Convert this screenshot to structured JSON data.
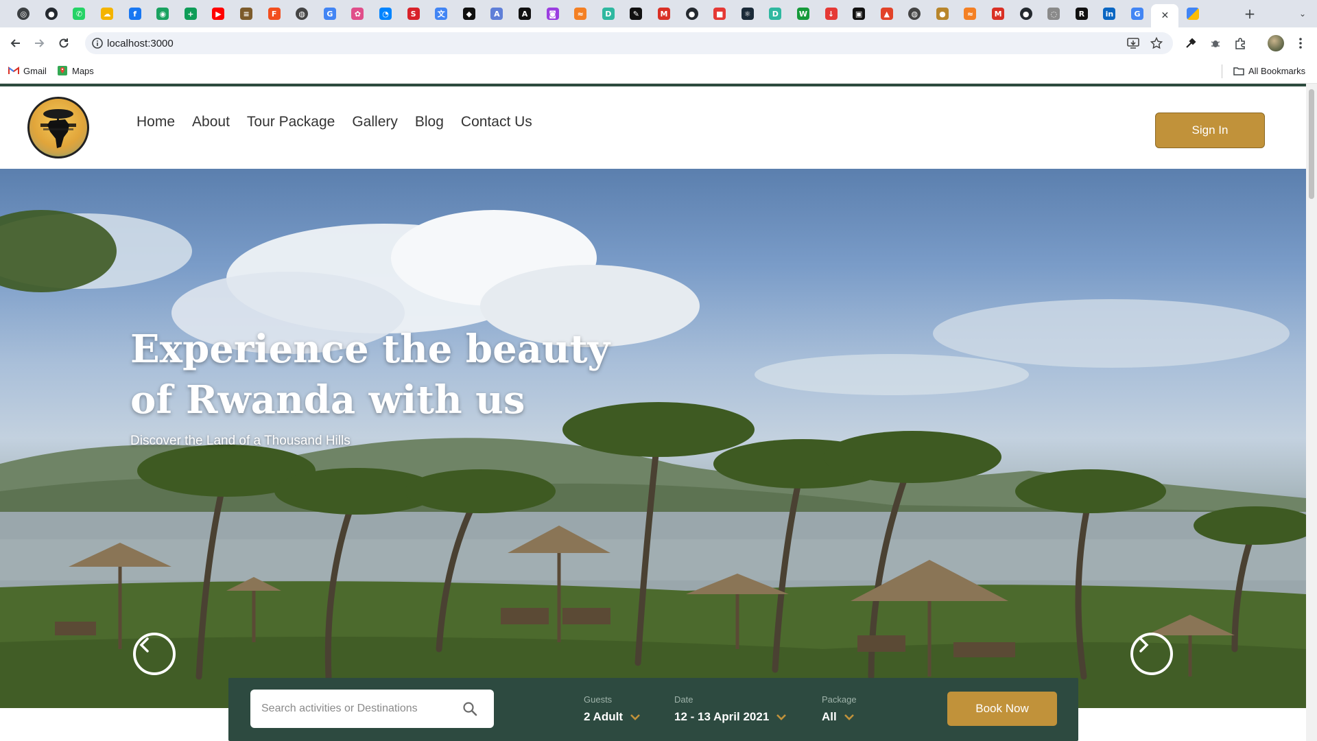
{
  "browser": {
    "tabs": [
      {
        "icon": "chrome-icon",
        "color": "#3c4043",
        "glyph": "◎"
      },
      {
        "icon": "github-icon",
        "color": "#24292f",
        "glyph": "●"
      },
      {
        "icon": "whatsapp-icon",
        "color": "#25d366",
        "glyph": "✆"
      },
      {
        "icon": "cloud-icon",
        "color": "#f4b400",
        "glyph": "☁"
      },
      {
        "icon": "facebook-icon",
        "color": "#1877f2",
        "glyph": "f"
      },
      {
        "icon": "green-circle-icon",
        "color": "#1aa260",
        "glyph": "◉"
      },
      {
        "icon": "sheets-plus-icon",
        "color": "#0f9d58",
        "glyph": "+"
      },
      {
        "icon": "youtube-icon",
        "color": "#ff0000",
        "glyph": "▶"
      },
      {
        "icon": "stack-icon",
        "color": "#7c5b2b",
        "glyph": "≡"
      },
      {
        "icon": "figma-icon",
        "color": "#f24e1e",
        "glyph": "F"
      },
      {
        "icon": "world-icon",
        "color": "#444",
        "glyph": "◍"
      },
      {
        "icon": "google-icon",
        "color": "#4285f4",
        "glyph": "G"
      },
      {
        "icon": "flower-icon",
        "color": "#e04e8a",
        "glyph": "✿"
      },
      {
        "icon": "messenger-icon",
        "color": "#0084ff",
        "glyph": "◔"
      },
      {
        "icon": "swirl-icon",
        "color": "#d8222a",
        "glyph": "S"
      },
      {
        "icon": "translate-icon",
        "color": "#4285f4",
        "glyph": "文"
      },
      {
        "icon": "diamond-icon",
        "color": "#111",
        "glyph": "◆"
      },
      {
        "icon": "a-icon",
        "color": "#5f7fd8",
        "glyph": "A"
      },
      {
        "icon": "a-dark-icon",
        "color": "#111",
        "glyph": "A"
      },
      {
        "icon": "chat-icon",
        "color": "#9b3de0",
        "glyph": "◙"
      },
      {
        "icon": "slash-icon",
        "color": "#f48024",
        "glyph": "≈"
      },
      {
        "icon": "d-icon",
        "color": "#2fb8a0",
        "glyph": "D"
      },
      {
        "icon": "pen-icon",
        "color": "#111",
        "glyph": "✎"
      },
      {
        "icon": "gmail-icon",
        "color": "#d93025",
        "glyph": "M"
      },
      {
        "icon": "github-icon",
        "color": "#24292f",
        "glyph": "●"
      },
      {
        "icon": "red-square-icon",
        "color": "#e53935",
        "glyph": "■"
      },
      {
        "icon": "atom-icon",
        "color": "#1b2a38",
        "glyph": "⚛"
      },
      {
        "icon": "d-icon",
        "color": "#2fb8a0",
        "glyph": "D"
      },
      {
        "icon": "w-icon",
        "color": "#159a3a",
        "glyph": "W"
      },
      {
        "icon": "download-icon",
        "color": "#e53935",
        "glyph": "↓"
      },
      {
        "icon": "square-icon",
        "color": "#111",
        "glyph": "▣"
      },
      {
        "icon": "gitlab-icon",
        "color": "#e24329",
        "glyph": "▲"
      },
      {
        "icon": "world-icon",
        "color": "#444",
        "glyph": "◍"
      },
      {
        "icon": "africa-logo-icon",
        "color": "#b8862c",
        "glyph": "●"
      },
      {
        "icon": "slash-icon",
        "color": "#f48024",
        "glyph": "≈"
      },
      {
        "icon": "gmail-icon",
        "color": "#d93025",
        "glyph": "M"
      },
      {
        "icon": "github-icon",
        "color": "#24292f",
        "glyph": "●"
      },
      {
        "icon": "spiral-icon",
        "color": "#8a8a8a",
        "glyph": "◌"
      },
      {
        "icon": "r-icon",
        "color": "#111",
        "glyph": "R"
      },
      {
        "icon": "linkedin-icon",
        "color": "#0a66c2",
        "glyph": "in"
      },
      {
        "icon": "google-icon",
        "color": "#4285f4",
        "glyph": "G"
      }
    ],
    "url": "localhost:3000",
    "bookmarks": [
      {
        "label": "Gmail",
        "icon": "gmail-icon"
      },
      {
        "label": "Maps",
        "icon": "maps-icon"
      }
    ],
    "all_bookmarks": "All Bookmarks"
  },
  "site": {
    "nav": [
      "Home",
      "About",
      "Tour Package",
      "Gallery",
      "Blog",
      "Contact Us"
    ],
    "sign_in": "Sign In",
    "hero_title": "Experience the beauty of Rwanda with us",
    "hero_subtitle": "Discover the Land of a Thousand Hills",
    "search_placeholder": "Search activities or Destinations",
    "guests_label": "Guests",
    "guests_value": "2 Adult",
    "date_label": "Date",
    "date_value": "12 - 13 April 2021",
    "package_label": "Package",
    "package_value": "All",
    "book_now": "Book Now",
    "accent": "#c1923a",
    "dark_green": "#2d4a40"
  }
}
